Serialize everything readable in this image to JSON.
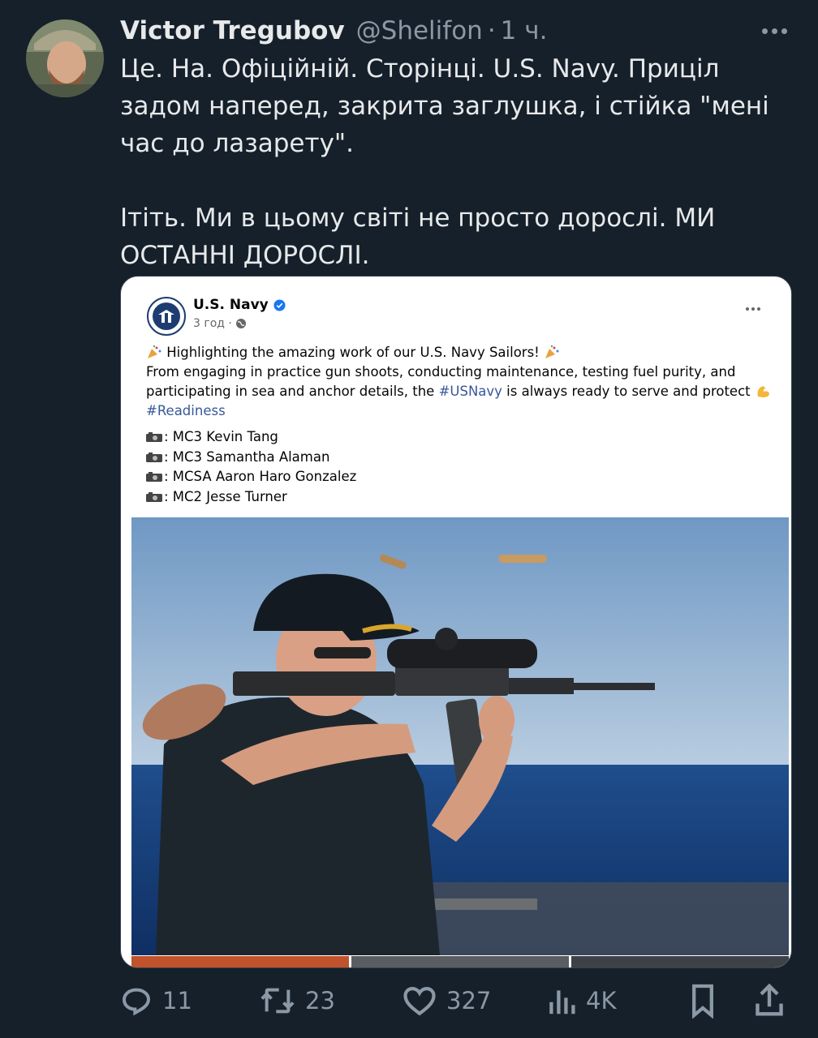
{
  "tweet": {
    "author_name": "Victor Tregubov",
    "handle": "@Shelifon",
    "separator": "·",
    "time": "1 ч.",
    "text_paragraphs": [
      "Це. На. Офіційній. Сторінці. U.S. Navy. Приціл задом наперед, закрита заглушка, і стійка \"мені час до лазарету\".",
      "Ітіть. Ми в цьому світі не просто дорослі. МИ ОСТАННІ ДОРОСЛІ."
    ]
  },
  "embedded_post": {
    "page_name": "U.S. Navy",
    "time": "3 год ·",
    "line1": " Highlighting the amazing work of our U.S. Navy Sailors! ",
    "line2": " From engaging in practice gun shoots, conducting maintenance, testing fuel purity, and",
    "line3_before": "participating in sea and anchor details, the ",
    "line3_hashtag": "#USNavy",
    "line3_after": " is always ready to serve and protect ",
    "hashtag_readiness": "#Readiness",
    "credits": [
      ": MC3 Kevin Tang",
      ": MC3 Samantha Alaman",
      ": MCSA Aaron Haro Gonzalez",
      ": MC2 Jesse Turner"
    ]
  },
  "actions": {
    "replies": "11",
    "retweets": "23",
    "likes": "327",
    "views": "4K"
  },
  "colors": {
    "background": "#15202b",
    "text": "#e7e9ea",
    "secondary": "#8b98a5",
    "fb_link": "#385898"
  },
  "icons": [
    "more-icon",
    "verified-icon",
    "globe-icon",
    "camera-icon",
    "party-popper-icon",
    "flexed-bicep-icon",
    "reply-icon",
    "retweet-icon",
    "like-icon",
    "views-icon",
    "bookmark-icon",
    "share-icon"
  ]
}
